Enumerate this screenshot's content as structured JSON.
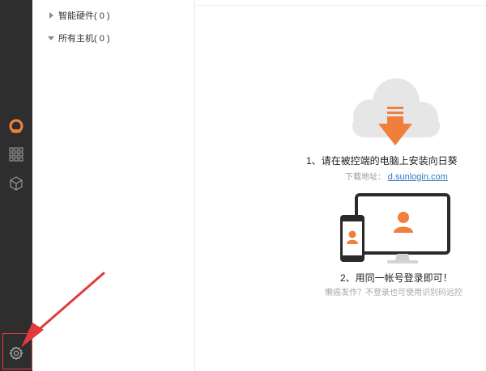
{
  "tree": {
    "hardware_label": "智能硬件( 0 )",
    "hosts_label": "所有主机( 0 )"
  },
  "main": {
    "step1": "1、请在被控端的电脑上安装向日葵",
    "download_label": "下载地址：",
    "download_link": "d.sunlogin.com",
    "step2": "2、用同一帐号登录即可！",
    "lazy_tip": "懒癌发作？不登录也可使用识别码远控"
  },
  "icons": {
    "logo": "sunlogin-logo-icon",
    "grid": "grid-apps-icon",
    "cube": "cube-icon",
    "settings": "gear-icon"
  },
  "colors": {
    "rail": "#2e2e2e",
    "accent": "#f07f3c",
    "link": "#2f78c6",
    "annotation": "#e23b3b"
  }
}
